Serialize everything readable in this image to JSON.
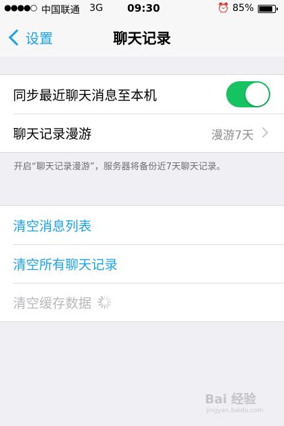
{
  "status": {
    "signal": "●●●●○",
    "carrier": "中国联通",
    "network": "3G",
    "time": "09:30",
    "battery": "85%",
    "battery_level": 0.85
  },
  "nav": {
    "back_label": "设置",
    "title": "聊天记录"
  },
  "settings": {
    "sync_label": "同步最近聊天消息至本机",
    "sync_enabled": true,
    "roaming_label": "聊天记录漫游",
    "roaming_value": "漫游7天",
    "note": "开启“聊天记录漫游”，服务器将备份近7天聊天记录。"
  },
  "actions": {
    "clear_list": "清空消息列表",
    "clear_all": "清空所有聊天记录",
    "clear_cache": "清空缓存数据"
  },
  "watermark": {
    "text": "Bai 经验",
    "sub": "jingyan.baidu.com"
  },
  "colors": {
    "accent": "#1aa3ec",
    "toggle_on": "#15c361",
    "background": "#efeff4"
  }
}
